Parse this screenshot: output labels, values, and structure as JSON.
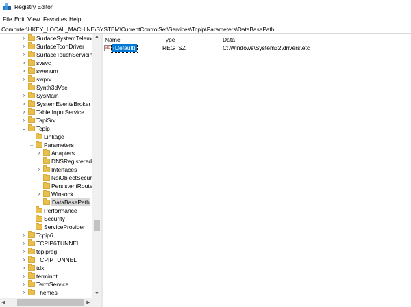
{
  "window": {
    "title": "Registry Editor"
  },
  "menu": [
    "File",
    "Edit",
    "View",
    "Favorites",
    "Help"
  ],
  "address": "Computer\\HKEY_LOCAL_MACHINE\\SYSTEM\\CurrentControlSet\\Services\\Tcpip\\Parameters\\DataBasePath",
  "tree": [
    {
      "label": "SurfaceSystemTeleme",
      "expander": "›"
    },
    {
      "label": "SurfaceTconDriver",
      "expander": "›"
    },
    {
      "label": "SurfaceTouchServicin",
      "expander": "›"
    },
    {
      "label": "svsvc",
      "expander": "›"
    },
    {
      "label": "swenum",
      "expander": "›"
    },
    {
      "label": "swprv",
      "expander": "›"
    },
    {
      "label": "Synth3dVsc",
      "expander": ""
    },
    {
      "label": "SysMain",
      "expander": "›"
    },
    {
      "label": "SystemEventsBroker",
      "expander": "›"
    },
    {
      "label": "TabletInputService",
      "expander": "›"
    },
    {
      "label": "TapiSrv",
      "expander": "›"
    },
    {
      "label": "Tcpip",
      "expander": "⌄"
    },
    {
      "label": "Linkage",
      "expander": ""
    },
    {
      "label": "Parameters",
      "expander": "⌄"
    },
    {
      "label": "Adapters",
      "expander": "›"
    },
    {
      "label": "DNSRegisteredA",
      "expander": ""
    },
    {
      "label": "Interfaces",
      "expander": "›"
    },
    {
      "label": "NsiObjectSecur",
      "expander": ""
    },
    {
      "label": "PersistentRoute",
      "expander": ""
    },
    {
      "label": "Winsock",
      "expander": "›"
    },
    {
      "label": "DataBasePath",
      "expander": ""
    },
    {
      "label": "Performance",
      "expander": ""
    },
    {
      "label": "Security",
      "expander": ""
    },
    {
      "label": "ServiceProvider",
      "expander": ""
    },
    {
      "label": "Tcpip6",
      "expander": "›"
    },
    {
      "label": "TCPIP6TUNNEL",
      "expander": "›"
    },
    {
      "label": "tcpipreg",
      "expander": "›"
    },
    {
      "label": "TCPIPTUNNEL",
      "expander": "›"
    },
    {
      "label": "tdx",
      "expander": "›"
    },
    {
      "label": "terminpt",
      "expander": "›"
    },
    {
      "label": "TermService",
      "expander": "›"
    },
    {
      "label": "Themes",
      "expander": "›"
    }
  ],
  "list": {
    "headers": {
      "name": "Name",
      "type": "Type",
      "data": "Data"
    },
    "rows": [
      {
        "icon": "ab",
        "name": "(Default)",
        "type": "REG_SZ",
        "data": "C:\\Windows\\System32\\drivers\\etc"
      }
    ]
  },
  "scroll": {
    "up": "▲",
    "down": "▼",
    "left": "◀",
    "right": "▶"
  },
  "colors": {
    "selection": "#0078d7",
    "folder": "#e8c04e",
    "tree_selection": "#d9d9d9"
  }
}
